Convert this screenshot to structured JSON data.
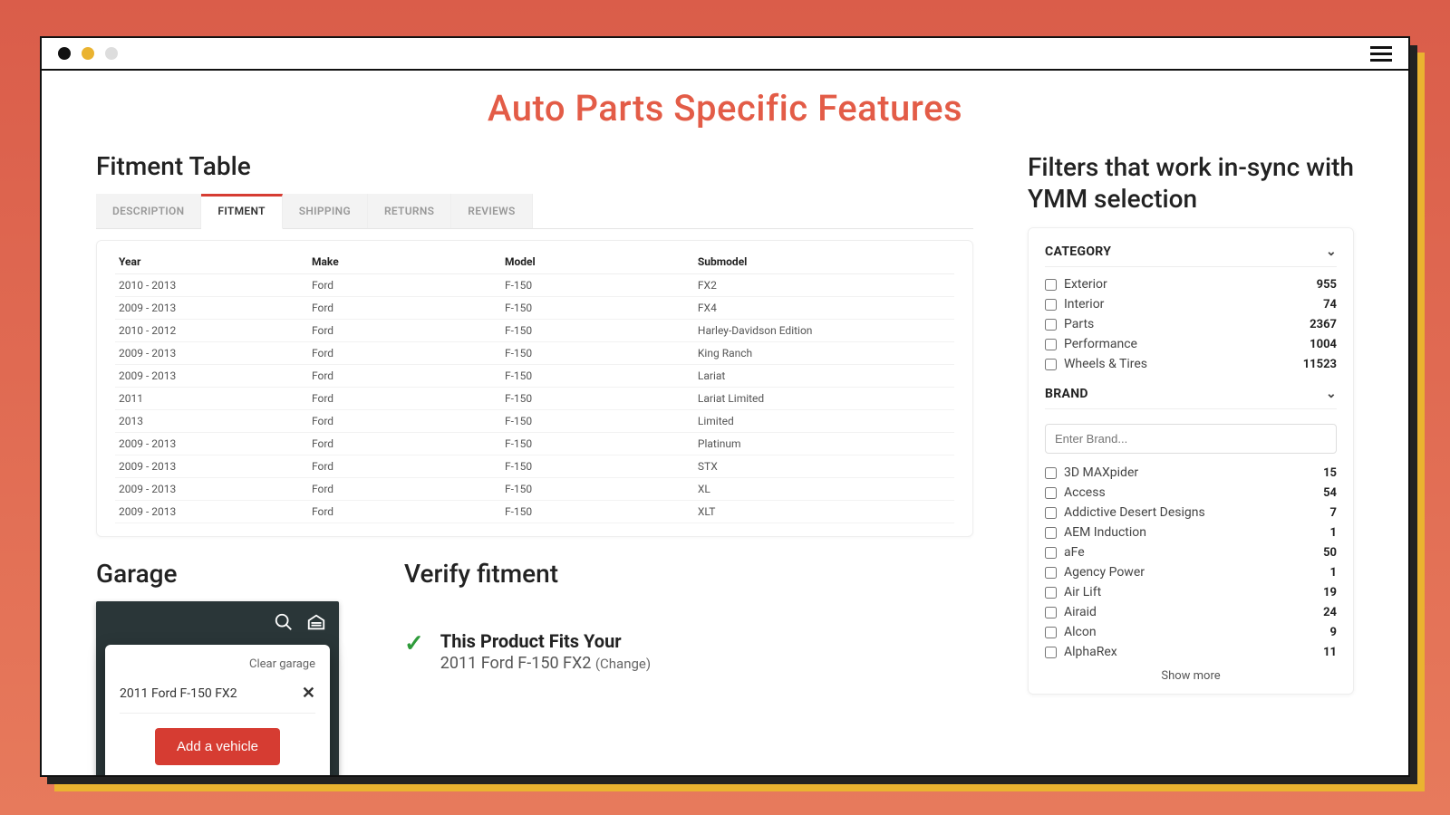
{
  "title": "Auto Parts Specific Features",
  "sections": {
    "fitment": "Fitment Table",
    "garage": "Garage",
    "verify": "Verify fitment",
    "filters": "Filters that work in-sync with YMM selection"
  },
  "tabs": [
    "DESCRIPTION",
    "FITMENT",
    "SHIPPING",
    "RETURNS",
    "REVIEWS"
  ],
  "active_tab_index": 1,
  "fitment_table": {
    "headers": [
      "Year",
      "Make",
      "Model",
      "Submodel"
    ],
    "rows": [
      [
        "2010 - 2013",
        "Ford",
        "F-150",
        "FX2"
      ],
      [
        "2009 - 2013",
        "Ford",
        "F-150",
        "FX4"
      ],
      [
        "2010 - 2012",
        "Ford",
        "F-150",
        "Harley-Davidson Edition"
      ],
      [
        "2009 - 2013",
        "Ford",
        "F-150",
        "King Ranch"
      ],
      [
        "2009 - 2013",
        "Ford",
        "F-150",
        "Lariat"
      ],
      [
        "2011",
        "Ford",
        "F-150",
        "Lariat Limited"
      ],
      [
        "2013",
        "Ford",
        "F-150",
        "Limited"
      ],
      [
        "2009 - 2013",
        "Ford",
        "F-150",
        "Platinum"
      ],
      [
        "2009 - 2013",
        "Ford",
        "F-150",
        "STX"
      ],
      [
        "2009 - 2013",
        "Ford",
        "F-150",
        "XL"
      ],
      [
        "2009 - 2013",
        "Ford",
        "F-150",
        "XLT"
      ]
    ]
  },
  "garage": {
    "clear_label": "Clear garage",
    "vehicle": "2011 Ford F-150 FX2",
    "add_label": "Add a vehicle"
  },
  "verify": {
    "line1": "This Product Fits Your",
    "line2": "2011 Ford F-150 FX2",
    "change": "(Change)"
  },
  "filters": {
    "category_label": "CATEGORY",
    "brand_label": "BRAND",
    "brand_placeholder": "Enter Brand...",
    "show_more": "Show more",
    "categories": [
      {
        "name": "Exterior",
        "count": 955
      },
      {
        "name": "Interior",
        "count": 74
      },
      {
        "name": "Parts",
        "count": 2367
      },
      {
        "name": "Performance",
        "count": 1004
      },
      {
        "name": "Wheels & Tires",
        "count": 11523
      }
    ],
    "brands": [
      {
        "name": "3D MAXpider",
        "count": 15
      },
      {
        "name": "Access",
        "count": 54
      },
      {
        "name": "Addictive Desert Designs",
        "count": 7
      },
      {
        "name": "AEM Induction",
        "count": 1
      },
      {
        "name": "aFe",
        "count": 50
      },
      {
        "name": "Agency Power",
        "count": 1
      },
      {
        "name": "Air Lift",
        "count": 19
      },
      {
        "name": "Airaid",
        "count": 24
      },
      {
        "name": "Alcon",
        "count": 9
      },
      {
        "name": "AlphaRex",
        "count": 11
      }
    ]
  }
}
